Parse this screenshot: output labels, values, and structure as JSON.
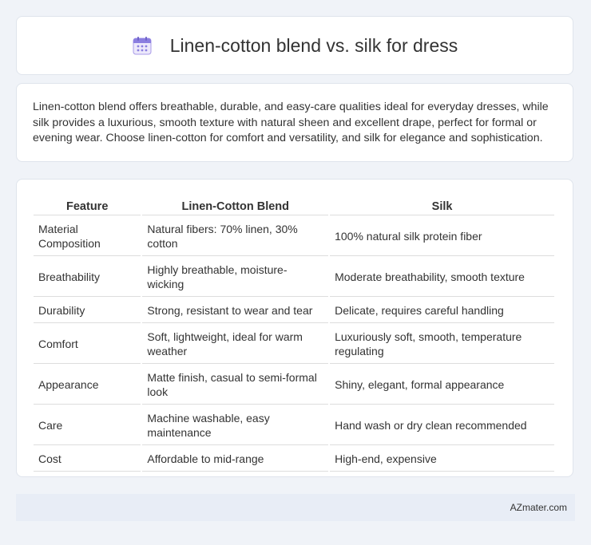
{
  "header": {
    "title": "Linen-cotton blend vs. silk for dress",
    "icon": "calendar-icon"
  },
  "summary": {
    "text": "Linen-cotton blend offers breathable, durable, and easy-care qualities ideal for everyday dresses, while silk provides a luxurious, smooth texture with natural sheen and excellent drape, perfect for formal or evening wear. Choose linen-cotton for comfort and versatility, and silk for elegance and sophistication."
  },
  "table": {
    "headers": [
      "Feature",
      "Linen-Cotton Blend",
      "Silk"
    ],
    "rows": [
      [
        "Material Composition",
        "Natural fibers: 70% linen, 30% cotton",
        "100% natural silk protein fiber"
      ],
      [
        "Breathability",
        "Highly breathable, moisture-wicking",
        "Moderate breathability, smooth texture"
      ],
      [
        "Durability",
        "Strong, resistant to wear and tear",
        "Delicate, requires careful handling"
      ],
      [
        "Comfort",
        "Soft, lightweight, ideal for warm weather",
        "Luxuriously soft, smooth, temperature regulating"
      ],
      [
        "Appearance",
        "Matte finish, casual to semi-formal look",
        "Shiny, elegant, formal appearance"
      ],
      [
        "Care",
        "Machine washable, easy maintenance",
        "Hand wash or dry clean recommended"
      ],
      [
        "Cost",
        "Affordable to mid-range",
        "High-end, expensive"
      ]
    ]
  },
  "footer": {
    "text": "AZmater.com"
  },
  "colors": {
    "background": "#f0f3f8",
    "card": "#ffffff",
    "footer_bg": "#e8edf6",
    "icon_accent": "#7b6fd6"
  }
}
